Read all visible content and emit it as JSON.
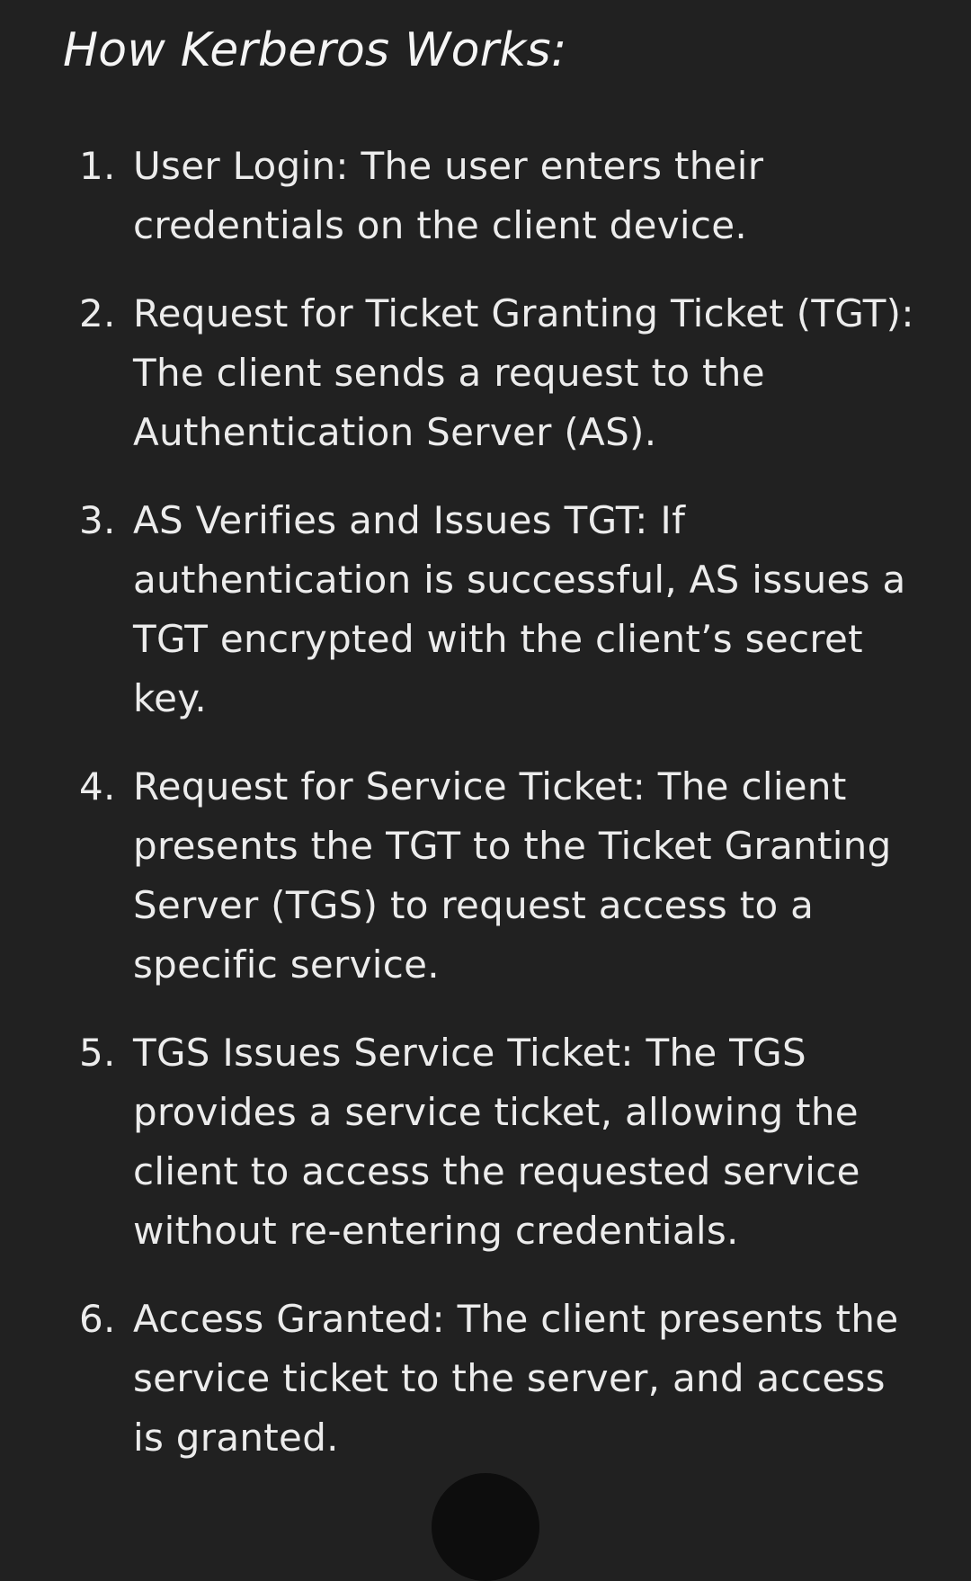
{
  "heading": "How Kerberos Works:",
  "steps": [
    {
      "number": "1.",
      "title": "User Login:",
      "text": " The user enters their credentials on the client device."
    },
    {
      "number": "2.",
      "title": "Request for Ticket Granting Ticket (TGT):",
      "text": " The client sends a request to the Authentication Server (AS)."
    },
    {
      "number": "3.",
      "title": "AS Verifies and Issues TGT:",
      "text": " If authentication is successful, AS issues a TGT encrypted with the client’s secret key."
    },
    {
      "number": "4.",
      "title": "Request for Service Ticket:",
      "text": " The client presents the TGT to the Ticket Granting Server (TGS) to request access to a specific service."
    },
    {
      "number": "5.",
      "title": "TGS Issues Service Ticket:",
      "text": " The TGS provides a service ticket, allowing the client to access the requested service without re-entering credentials."
    },
    {
      "number": "6.",
      "title": "Access Granted:",
      "text": " The client presents the service ticket to the server, and access is granted."
    }
  ]
}
